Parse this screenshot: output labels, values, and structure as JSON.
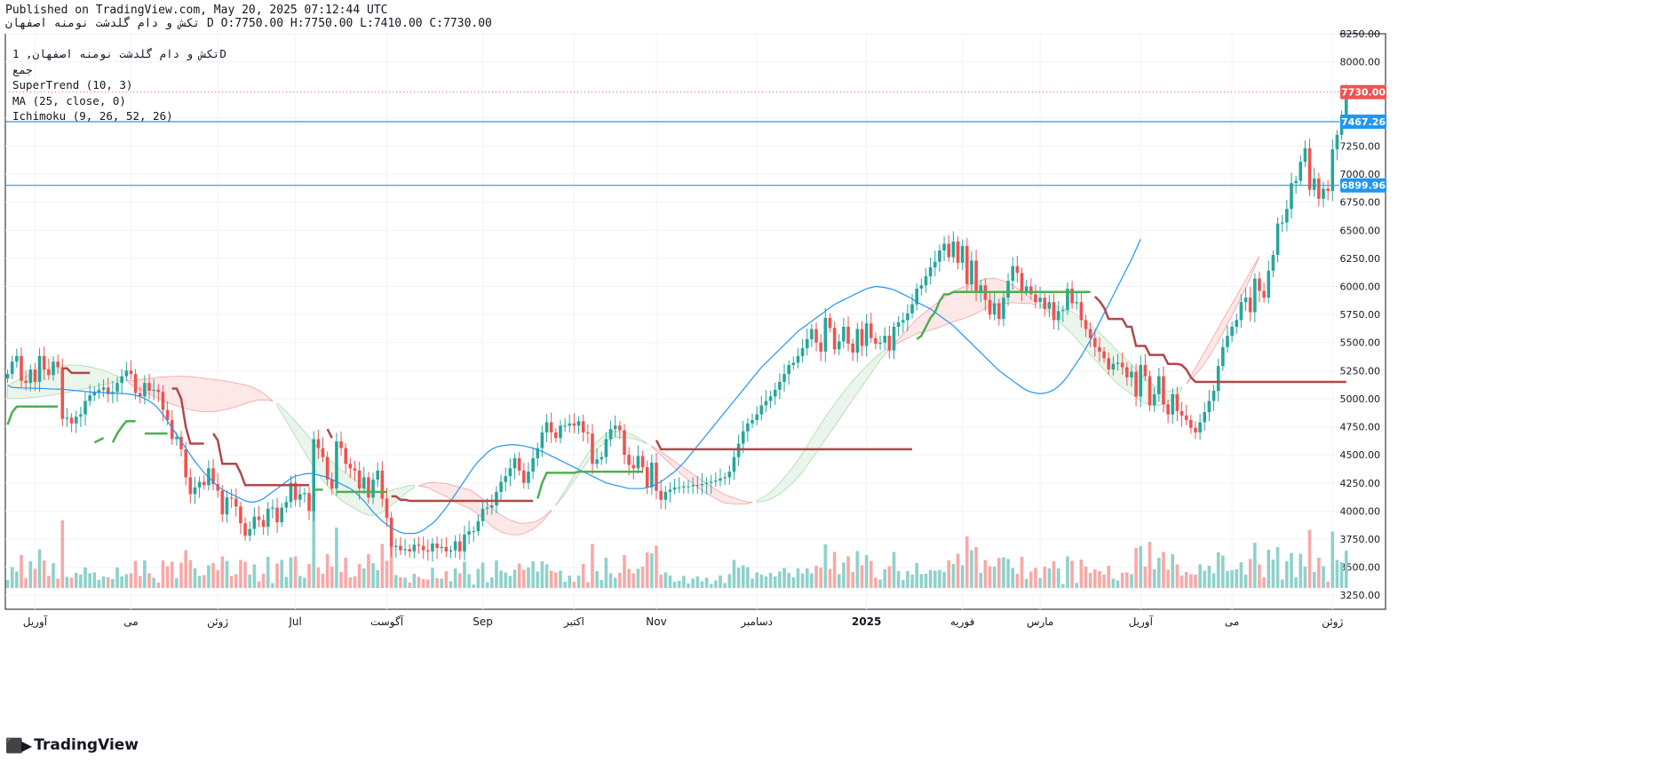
{
  "header": {
    "published": "Published on TradingView.com, May 20, 2025 07:12:44 UTC",
    "ohlc": "تکش و دام گلدشت نومنه اصفهان D O:7750.00 H:7750.00 L:7410.00 C:7730.00"
  },
  "legend": {
    "symbol": "تکش و دام گلدشت نومنه اصفهان, 1D",
    "symbol_sub": "جمع",
    "indicators": [
      "SuperTrend (10, 3)",
      "MA (25, close, 0)",
      "Ichimoku (9, 26, 52, 26)"
    ]
  },
  "brand": {
    "name": "TradingView",
    "logo": "tradingview-logo-icon"
  },
  "colors": {
    "up": "#26a69a",
    "down": "#ef5350",
    "supertrend_up": "#4caf50",
    "supertrend_down": "#b0484a",
    "ma": "#2196f3",
    "kumo_bull": "#e8f5e9",
    "kumo_bear": "#fde5e5",
    "hline": "#2196f3",
    "vol_up": "#8fd1cb",
    "vol_down": "#f7a9a7"
  },
  "chart_data": {
    "type": "candlestick",
    "price_axis": {
      "min": 3125,
      "max": 8250,
      "ticks": [
        3250,
        3500,
        3750,
        4000,
        4250,
        4500,
        4750,
        5000,
        5250,
        5500,
        5750,
        6000,
        6250,
        6500,
        6750,
        7000,
        7250,
        7500,
        8000,
        8250
      ]
    },
    "price_labels": [
      {
        "value": 7730.0,
        "text": "7730.00",
        "color": "#ef5350"
      },
      {
        "value": 7467.26,
        "text": "7467.26",
        "color": "#2196f3"
      },
      {
        "value": 6899.96,
        "text": "6899.96",
        "color": "#2196f3"
      }
    ],
    "horizontal_lines": [
      7467.26,
      6899.96
    ],
    "time_axis": {
      "labels": [
        {
          "text": "آوریل",
          "bar": 6
        },
        {
          "text": "می",
          "bar": 27
        },
        {
          "text": "ژوئن",
          "bar": 46
        },
        {
          "text": "Jul",
          "bar": 63
        },
        {
          "text": "آگوست",
          "bar": 83
        },
        {
          "text": "Sep",
          "bar": 104
        },
        {
          "text": "اکتبر",
          "bar": 124
        },
        {
          "text": "Nov",
          "bar": 142
        },
        {
          "text": "دسامبر",
          "bar": 164
        },
        {
          "text": "2025",
          "bar": 188
        },
        {
          "text": "فوریه",
          "bar": 209
        },
        {
          "text": "مارس",
          "bar": 226
        },
        {
          "text": "آوریل",
          "bar": 248
        },
        {
          "text": "می",
          "bar": 268
        },
        {
          "text": "ژوئن",
          "bar": 290
        }
      ],
      "bar_count": 292,
      "last_bar": 280
    },
    "closes": [
      5220,
      5330,
      5380,
      5160,
      5140,
      5260,
      5150,
      5380,
      5260,
      5210,
      5330,
      5280,
      4820,
      4830,
      4780,
      4840,
      4860,
      4980,
      5030,
      5060,
      5080,
      5100,
      5040,
      5060,
      5140,
      5200,
      5250,
      5220,
      5050,
      5020,
      5140,
      5070,
      5080,
      5060,
      4900,
      4810,
      4640,
      4660,
      4550,
      4300,
      4150,
      4210,
      4260,
      4230,
      4380,
      4240,
      4180,
      3970,
      4120,
      4110,
      4040,
      3890,
      3780,
      3840,
      3950,
      3920,
      3860,
      4020,
      4030,
      3900,
      4030,
      4080,
      4250,
      4100,
      4150,
      4160,
      4000,
      4640,
      4560,
      4480,
      4280,
      4200,
      4620,
      4560,
      4420,
      4380,
      4360,
      4200,
      4300,
      4120,
      4280,
      4360,
      4110,
      3940,
      3680,
      3690,
      3650,
      3660,
      3640,
      3700,
      3690,
      3650,
      3640,
      3710,
      3670,
      3680,
      3640,
      3650,
      3730,
      3640,
      3790,
      3820,
      3820,
      3910,
      4020,
      4030,
      4050,
      4170,
      4260,
      4310,
      4380,
      4470,
      4360,
      4250,
      4350,
      4470,
      4560,
      4700,
      4790,
      4700,
      4650,
      4760,
      4760,
      4780,
      4760,
      4800,
      4700,
      4690,
      4420,
      4460,
      4480,
      4640,
      4730,
      4760,
      4720,
      4500,
      4410,
      4380,
      4490,
      4390,
      4210,
      4430,
      4180,
      4100,
      4170,
      4190,
      4210,
      4210,
      4220,
      4220,
      4230,
      4230,
      4240,
      4250,
      4260,
      4270,
      4290,
      4300,
      4350,
      4480,
      4600,
      4710,
      4780,
      4810,
      4860,
      4940,
      4980,
      5020,
      5080,
      5150,
      5220,
      5300,
      5320,
      5380,
      5450,
      5530,
      5620,
      5500,
      5420,
      5720,
      5630,
      5440,
      5510,
      5640,
      5490,
      5410,
      5620,
      5470,
      5670,
      5540,
      5490,
      5500,
      5560,
      5430,
      5640,
      5680,
      5700,
      5760,
      5840,
      5980,
      6010,
      6090,
      6170,
      6220,
      6320,
      6380,
      6260,
      6400,
      6210,
      6360,
      6020,
      6230,
      5950,
      6010,
      5880,
      5750,
      5850,
      5710,
      5900,
      6050,
      6180,
      6120,
      5960,
      6000,
      5930,
      5860,
      5900,
      5800,
      5860,
      5700,
      5780,
      5790,
      5980,
      5850,
      5860,
      5700,
      5620,
      5540,
      5460,
      5420,
      5360,
      5260,
      5310,
      5320,
      5280,
      5190,
      5240,
      5020,
      5300,
      5200,
      4940,
      5040,
      5200,
      4950,
      4860,
      5040,
      4890,
      4850,
      4810,
      4740,
      4700,
      4790,
      4880,
      4980,
      5070,
      5290,
      5460,
      5560,
      5640,
      5700,
      5860,
      5900,
      5770,
      6070,
      5960,
      5900,
      6140,
      6280,
      6560,
      6570,
      6690,
      6920,
      6940,
      7110,
      7230,
      6860,
      6960,
      6780,
      6870,
      6850,
      7220,
      7350,
      7510,
      7730
    ],
    "ma": [
      5120,
      5100,
      5098,
      5096,
      5095,
      5094,
      5093,
      5092,
      5090,
      5088,
      5086,
      5085,
      5084,
      5080,
      5076,
      5072,
      5068,
      5064,
      5060,
      5058,
      5056,
      5055,
      5052,
      5050,
      5048,
      5046,
      5044,
      5040,
      5030,
      5020,
      5000,
      4980,
      4950,
      4910,
      4860,
      4800,
      4740,
      4680,
      4620,
      4560,
      4500,
      4440,
      4390,
      4340,
      4300,
      4260,
      4220,
      4190,
      4170,
      4150,
      4130,
      4110,
      4090,
      4080,
      4080,
      4090,
      4110,
      4140,
      4170,
      4200,
      4230,
      4260,
      4290,
      4310,
      4320,
      4330,
      4335,
      4330,
      4320,
      4310,
      4300,
      4280,
      4260,
      4240,
      4220,
      4200,
      4170,
      4130,
      4090,
      4040,
      3990,
      3950,
      3910,
      3880,
      3850,
      3830,
      3810,
      3800,
      3800,
      3800,
      3810,
      3830,
      3860,
      3890,
      3930,
      3980,
      4030,
      4090,
      4150,
      4210,
      4270,
      4330,
      4390,
      4440,
      4480,
      4520,
      4550,
      4570,
      4580,
      4585,
      4590,
      4590,
      4585,
      4580,
      4570,
      4560,
      4545,
      4530,
      4510,
      4490,
      4470,
      4450,
      4430,
      4410,
      4390,
      4370,
      4350,
      4330,
      4310,
      4290,
      4270,
      4250,
      4240,
      4230,
      4220,
      4210,
      4200,
      4200,
      4200,
      4200,
      4210,
      4220,
      4240,
      4260,
      4290,
      4320,
      4350,
      4390,
      4430,
      4480,
      4530,
      4580,
      4630,
      4680,
      4730,
      4780,
      4830,
      4880,
      4930,
      4980,
      5030,
      5080,
      5130,
      5180,
      5230,
      5280,
      5320,
      5360,
      5400,
      5440,
      5480,
      5520,
      5560,
      5600,
      5630,
      5660,
      5690,
      5720,
      5750,
      5780,
      5810,
      5840,
      5860,
      5880,
      5900,
      5920,
      5940,
      5960,
      5980,
      5990,
      6000,
      5995,
      5990,
      5980,
      5970,
      5950,
      5930,
      5910,
      5890,
      5860,
      5840,
      5820,
      5800,
      5770,
      5740,
      5710,
      5680,
      5650,
      5610,
      5570,
      5530,
      5490,
      5450,
      5410,
      5370,
      5330,
      5290,
      5250,
      5220,
      5190,
      5160,
      5130,
      5100,
      5075,
      5060,
      5050,
      5045,
      5050,
      5060,
      5080,
      5110,
      5150,
      5200,
      5260,
      5320,
      5380,
      5450,
      5520,
      5600,
      5680,
      5760,
      5840,
      5920,
      6000,
      6080,
      6160,
      6240,
      6330,
      6420
    ]
  }
}
